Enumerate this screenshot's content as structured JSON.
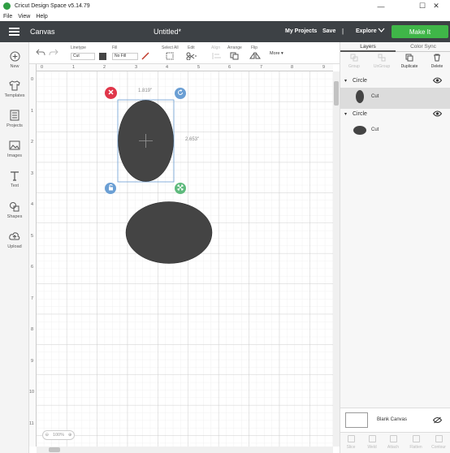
{
  "window": {
    "title": "Cricut Design Space  v5.14.79",
    "minimize": "—",
    "maximize": "☐",
    "close": "✕"
  },
  "menu": [
    "File",
    "View",
    "Help"
  ],
  "header": {
    "section": "Canvas",
    "doc_title": "Untitled*",
    "my_projects": "My Projects",
    "save": "Save",
    "separator": "|",
    "explore": "Explore",
    "make_it": "Make It"
  },
  "leftbar": [
    {
      "label": "New",
      "icon": "plus-circle-icon"
    },
    {
      "label": "Templates",
      "icon": "shirt-icon"
    },
    {
      "label": "Projects",
      "icon": "projects-icon"
    },
    {
      "label": "Images",
      "icon": "image-icon"
    },
    {
      "label": "Text",
      "icon": "text-icon"
    },
    {
      "label": "Shapes",
      "icon": "shapes-icon"
    },
    {
      "label": "Upload",
      "icon": "upload-icon"
    }
  ],
  "toolbar": {
    "linetype_label": "Linetype",
    "linetype_value": "Cut",
    "fill_label": "Fill",
    "fill_value": "No Fill",
    "select_all": "Select All",
    "edit": "Edit",
    "align": "Align",
    "arrange": "Arrange",
    "flip": "Flip",
    "more": "More ▾"
  },
  "canvas": {
    "ruler_top": [
      "0",
      "1",
      "2",
      "3",
      "4",
      "5",
      "6",
      "7",
      "8",
      "9"
    ],
    "ruler_left": [
      "0",
      "1",
      "2",
      "3",
      "4",
      "5",
      "6",
      "7",
      "8",
      "9",
      "10",
      "11"
    ],
    "width_dim": "1.819\"",
    "height_dim": "2.653\"",
    "zoom_minus": "⊖",
    "zoom_value": "100%",
    "zoom_plus": "⊕",
    "shape_color": "#444444",
    "delete_handle_color": "#e0364a",
    "handle_color": "#6b9fd4",
    "resize_handle_color": "#5fba7d"
  },
  "layers_panel": {
    "tabs": [
      "Layers",
      "Color Sync"
    ],
    "actions": [
      "Group",
      "UnGroup",
      "Duplicate",
      "Delete"
    ],
    "groups": [
      {
        "name": "Circle",
        "layer_label": "Cut",
        "selected": true
      },
      {
        "name": "Circle",
        "layer_label": "Cut",
        "selected": false
      }
    ],
    "blank_canvas": "Blank Canvas",
    "bottom_actions": [
      "Slice",
      "Weld",
      "Attach",
      "Flatten",
      "Contour"
    ]
  }
}
